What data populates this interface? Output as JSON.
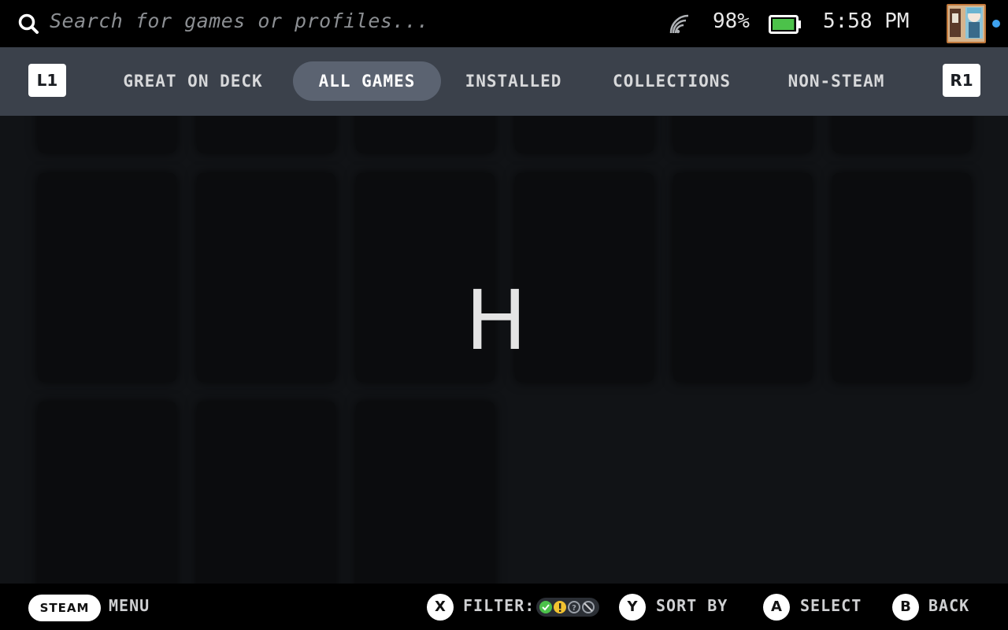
{
  "topbar": {
    "search_placeholder": "Search for games or profiles...",
    "battery_percent": "98%",
    "battery_level": 0.98,
    "time": "5:58 PM",
    "icons": [
      "search-icon",
      "wifi-icon",
      "battery-icon",
      "avatar",
      "notification-dot"
    ],
    "accent_color": "#3ea2f0",
    "battery_color": "#4cc24a"
  },
  "tabs": {
    "left_shoulder": "L1",
    "right_shoulder": "R1",
    "items": [
      {
        "label": "GREAT ON DECK",
        "active": false
      },
      {
        "label": "ALL GAMES",
        "active": true
      },
      {
        "label": "INSTALLED",
        "active": false
      },
      {
        "label": "COLLECTIONS",
        "active": false
      },
      {
        "label": "NON-STEAM",
        "active": false
      }
    ]
  },
  "library": {
    "jump_letter": "H"
  },
  "footer": {
    "steam_label": "STEAM",
    "menu_label": "MENU",
    "x_button": "X",
    "filter_label": "FILTER:",
    "y_button": "Y",
    "sort_label": "SORT BY",
    "a_button": "A",
    "select_label": "SELECT",
    "b_button": "B",
    "back_label": "BACK",
    "filter_icon_colors": [
      "#4cc24a",
      "#f2c230",
      "#9aa0a8",
      "#9aa0a8"
    ]
  }
}
